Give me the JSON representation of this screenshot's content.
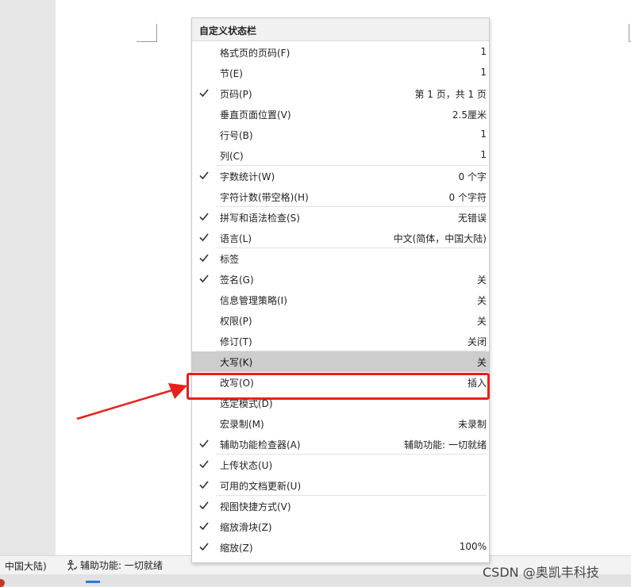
{
  "menu": {
    "title": "自定义状态栏",
    "items": [
      {
        "label": "格式页的页码(F)",
        "value": "1",
        "checked": false
      },
      {
        "label": "节(E)",
        "value": "1",
        "checked": false
      },
      {
        "label": "页码(P)",
        "value": "第 1 页，共 1 页",
        "checked": true
      },
      {
        "label": "垂直页面位置(V)",
        "value": "2.5厘米",
        "checked": false
      },
      {
        "label": "行号(B)",
        "value": "1",
        "checked": false
      },
      {
        "label": "列(C)",
        "value": "1",
        "checked": false
      },
      {
        "label": "字数统计(W)",
        "value": "0 个字",
        "checked": true
      },
      {
        "label": "字符计数(带空格)(H)",
        "value": "0 个字符",
        "checked": false
      },
      {
        "label": "拼写和语法检查(S)",
        "value": "无错误",
        "checked": true
      },
      {
        "label": "语言(L)",
        "value": "中文(简体，中国大陆)",
        "checked": true
      },
      {
        "label": "标签",
        "value": "",
        "checked": true
      },
      {
        "label": "签名(G)",
        "value": "关",
        "checked": true
      },
      {
        "label": "信息管理策略(I)",
        "value": "关",
        "checked": false
      },
      {
        "label": "权限(P)",
        "value": "关",
        "checked": false
      },
      {
        "label": "修订(T)",
        "value": "关闭",
        "checked": false
      },
      {
        "label": "大写(K)",
        "value": "关",
        "checked": false
      },
      {
        "label": "改写(O)",
        "value": "插入",
        "checked": false
      },
      {
        "label": "选定模式(D)",
        "value": "",
        "checked": false
      },
      {
        "label": "宏录制(M)",
        "value": "未录制",
        "checked": false
      },
      {
        "label": "辅助功能检查器(A)",
        "value": "辅助功能: 一切就绪",
        "checked": true
      },
      {
        "label": "上传状态(U)",
        "value": "",
        "checked": true
      },
      {
        "label": "可用的文档更新(U)",
        "value": "",
        "checked": true
      },
      {
        "label": "视图快捷方式(V)",
        "value": "",
        "checked": true
      },
      {
        "label": "缩放滑块(Z)",
        "value": "",
        "checked": true
      },
      {
        "label": "缩放(Z)",
        "value": "100%",
        "checked": true
      }
    ]
  },
  "statusbar": {
    "language": "中国大陆)",
    "accessibility": "辅助功能: 一切就绪"
  },
  "watermark": "CSDN @奥凯丰科技",
  "colors": {
    "highlight": "#cdcdcd",
    "callout": "#e8201a"
  }
}
